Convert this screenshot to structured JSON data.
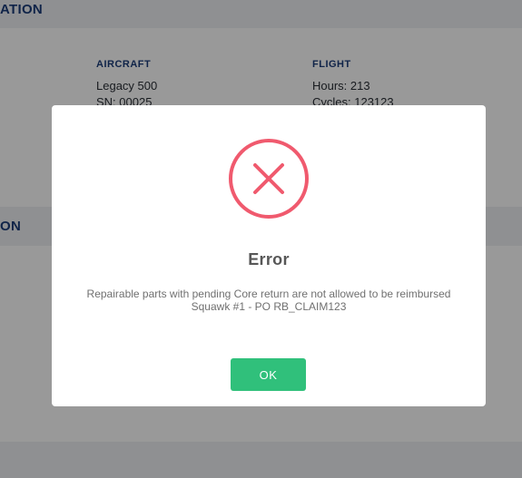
{
  "sections": {
    "top_title": "ATION",
    "middle_title": "ON"
  },
  "aircraft": {
    "heading": "AIRCRAFT",
    "model": "Legacy 500",
    "serial": "SN: 00025"
  },
  "flight": {
    "heading": "FLIGHT",
    "hours": "Hours: 213",
    "cycles": "Cycles: 123123"
  },
  "dialog": {
    "icon": "error-x-circle-icon",
    "title": "Error",
    "message_line1": "Repairable parts with pending Core return are not allowed to be reimbursed",
    "message_line2": "Squawk #1 - PO RB_CLAIM123",
    "ok_label": "OK"
  },
  "colors": {
    "accent_green": "#30c07b",
    "error_red": "#f05a6e",
    "heading_blue": "#1c3d7a"
  }
}
